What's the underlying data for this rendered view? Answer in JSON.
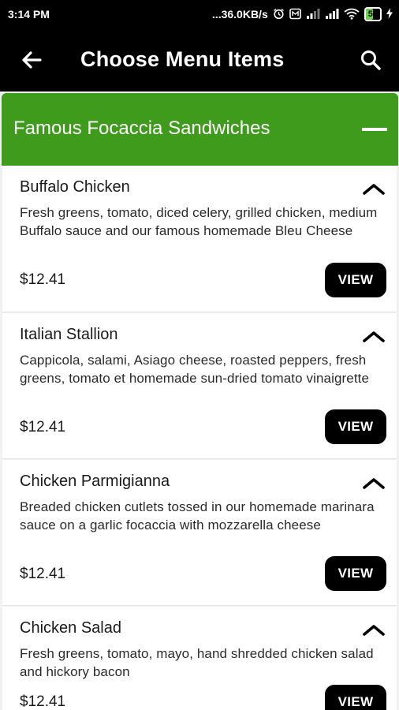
{
  "status_bar": {
    "time": "3:14 PM",
    "network_speed": "...36.0KB/s",
    "battery_level": "50",
    "battery_fraction": 0.5,
    "icons": [
      "alarm-icon",
      "data-saver-icon",
      "signal-icon",
      "signal-icon",
      "wifi-icon",
      "battery-icon",
      "charging-icon"
    ]
  },
  "app_bar": {
    "title": "Choose Menu Items",
    "back_icon": "arrow-left-icon",
    "search_icon": "search-icon"
  },
  "category": {
    "title": "Famous Focaccia Sandwiches",
    "icon": "collapse-minus-icon"
  },
  "items": [
    {
      "name": "Buffalo Chicken",
      "description": "Fresh greens, tomato, diced celery, grilled chicken, medium Buffalo sauce and our famous homemade Bleu Cheese",
      "price": "$12.41",
      "button": "VIEW"
    },
    {
      "name": "Italian Stallion",
      "description": "Cappicola, salami, Asiago cheese, roasted peppers, fresh greens, tomato et homemade sun-dried tomato vinaigrette",
      "price": "$12.41",
      "button": "VIEW"
    },
    {
      "name": "Chicken Parmigianna",
      "description": "Breaded chicken cutlets tossed in our homemade marinara sauce on a garlic focaccia with mozzarella cheese",
      "price": "$12.41",
      "button": "VIEW"
    },
    {
      "name": "Chicken Salad",
      "description": "Fresh greens, tomato, mayo, hand shredded chicken salad and hickory bacon",
      "price": "$12.41",
      "button": "VIEW"
    }
  ],
  "colors": {
    "accent_green": "#3e9b1b",
    "bar_background": "#000000",
    "card_background": "#ffffff"
  }
}
